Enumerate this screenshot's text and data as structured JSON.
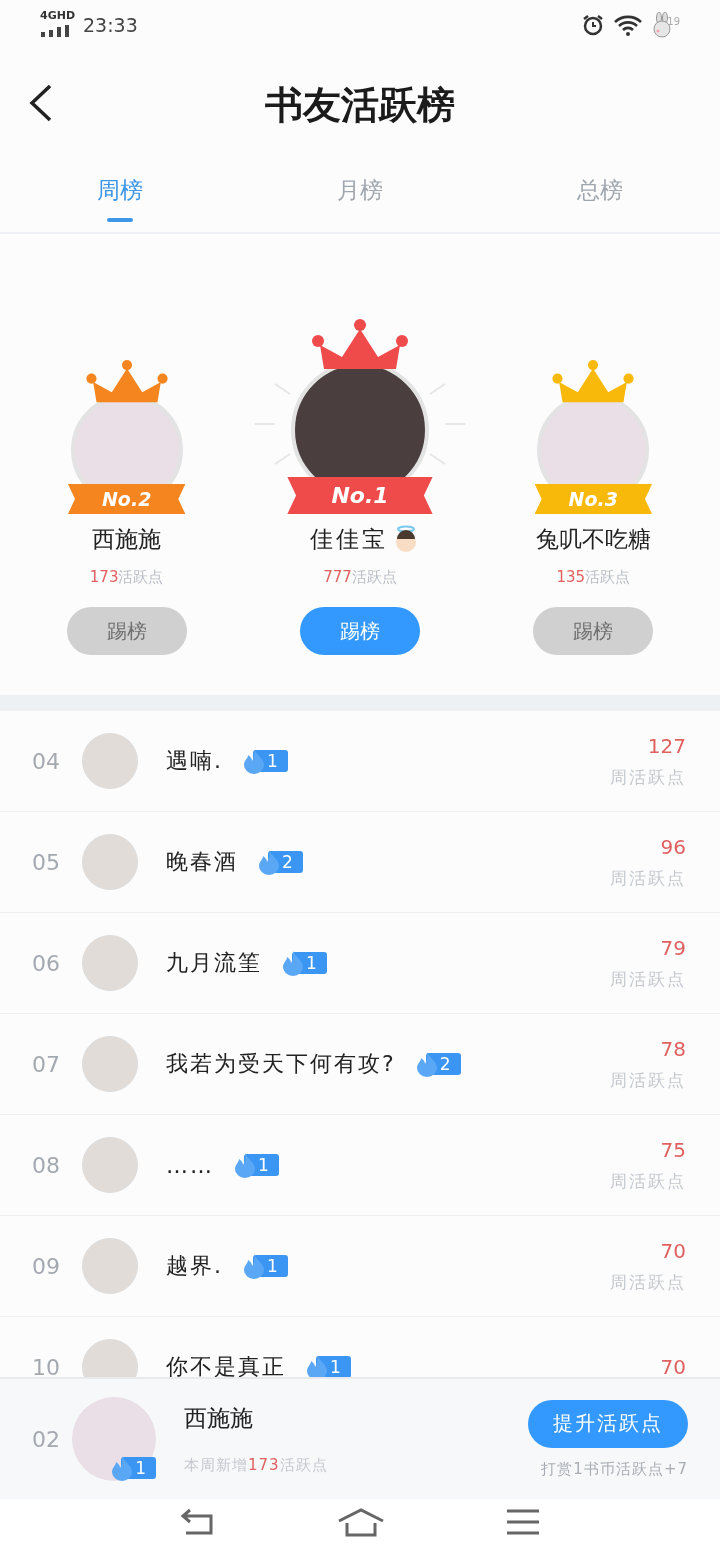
{
  "status_bar": {
    "network": "4GHD",
    "time": "23:33",
    "badge": "19"
  },
  "header": {
    "title": "书友活跃榜"
  },
  "tabs": [
    {
      "label": "周榜",
      "selected": true
    },
    {
      "label": "月榜",
      "selected": false
    },
    {
      "label": "总榜",
      "selected": false
    }
  ],
  "podium": [
    {
      "rank": "No.2",
      "color": "#f5861f",
      "name": "西施施",
      "angel": false,
      "points": "173",
      "points_label": "活跃点",
      "button": "踢榜",
      "disabled": true,
      "first": false
    },
    {
      "rank": "No.1",
      "color": "#ef4b4b",
      "name": "佳佳宝",
      "angel": true,
      "points": "777",
      "points_label": "活跃点",
      "button": "踢榜",
      "disabled": false,
      "first": true
    },
    {
      "rank": "No.3",
      "color": "#f9b90a",
      "name": "兔叽不吃糖",
      "angel": false,
      "points": "135",
      "points_label": "活跃点",
      "button": "踢榜",
      "disabled": true,
      "first": false
    }
  ],
  "rows": [
    {
      "rank": "04",
      "name": "遇喃.",
      "level": "1",
      "score": "127",
      "score_label": "周活跃点"
    },
    {
      "rank": "05",
      "name": "晚春酒",
      "level": "2",
      "score": "96",
      "score_label": "周活跃点"
    },
    {
      "rank": "06",
      "name": "九月流筀",
      "level": "1",
      "score": "79",
      "score_label": "周活跃点"
    },
    {
      "rank": "07",
      "name": "我若为受天下何有攻?",
      "level": "2",
      "score": "78",
      "score_label": "周活跃点"
    },
    {
      "rank": "08",
      "name": "……",
      "level": "1",
      "score": "75",
      "score_label": "周活跃点"
    },
    {
      "rank": "09",
      "name": "越界.",
      "level": "1",
      "score": "70",
      "score_label": "周活跃点"
    },
    {
      "rank": "10",
      "name": "你不是真正",
      "level": "1",
      "score": "70"
    }
  ],
  "me": {
    "rank": "02",
    "name": "西施施",
    "level": "1",
    "prefix": "本周新增",
    "points": "173",
    "suffix": "活跃点",
    "button": "提升活跃点",
    "hint": "打赏1书币活跃点+7"
  }
}
